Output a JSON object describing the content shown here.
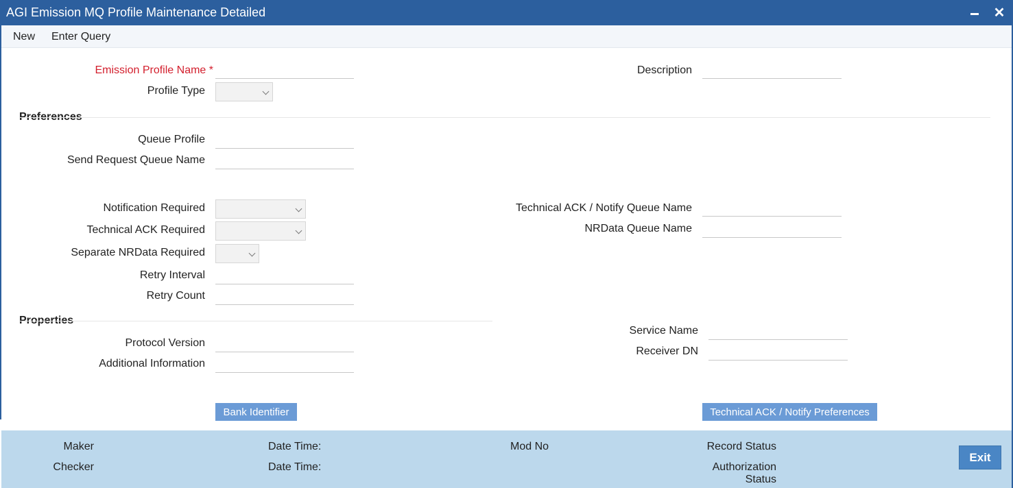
{
  "window": {
    "title": "AGI Emission MQ Profile Maintenance Detailed"
  },
  "menu": {
    "new": "New",
    "enter_query": "Enter Query"
  },
  "form": {
    "emission_profile_name": {
      "label": "Emission Profile Name",
      "required_mark": "*",
      "value": ""
    },
    "description": {
      "label": "Description",
      "value": ""
    },
    "profile_type": {
      "label": "Profile Type",
      "value": ""
    },
    "queue_profile": {
      "label": "Queue Profile",
      "value": ""
    },
    "send_request_queue_name": {
      "label": "Send Request Queue Name",
      "value": ""
    },
    "notification_required": {
      "label": "Notification Required",
      "value": ""
    },
    "technical_ack_required": {
      "label": "Technical ACK Required",
      "value": ""
    },
    "separate_nrdata_required": {
      "label": "Separate NRData Required",
      "value": ""
    },
    "retry_interval": {
      "label": "Retry Interval",
      "value": ""
    },
    "retry_count": {
      "label": "Retry Count",
      "value": ""
    },
    "technical_ack_notify_queue_name": {
      "label": "Technical ACK / Notify Queue Name",
      "value": ""
    },
    "nrdata_queue_name": {
      "label": "NRData Queue Name",
      "value": ""
    },
    "protocol_version": {
      "label": "Protocol Version",
      "value": ""
    },
    "additional_information": {
      "label": "Additional Information",
      "value": ""
    },
    "service_name": {
      "label": "Service Name",
      "value": ""
    },
    "receiver_dn": {
      "label": "Receiver DN",
      "value": ""
    }
  },
  "sections": {
    "preferences": "Preferences",
    "properties": "Properties"
  },
  "buttons": {
    "bank_identifier": "Bank Identifier",
    "technical_ack_notify_preferences": "Technical ACK / Notify Preferences",
    "exit": "Exit"
  },
  "footer": {
    "maker": "Maker",
    "checker": "Checker",
    "date_time_1": "Date Time:",
    "date_time_2": "Date Time:",
    "mod_no": "Mod No",
    "record_status": "Record Status",
    "authorization_status_line1": "Authorization",
    "authorization_status_line2": "Status"
  },
  "colors": {
    "title_bar": "#2c5f9e",
    "required_label": "#d31f2d",
    "action_button": "#6b9bd6",
    "footer_bg": "#bcd8ec",
    "exit_button": "#4a86c5"
  },
  "icons": {
    "minimize": "minimize-icon",
    "close": "close-icon",
    "dropdown": "chevron-down-icon"
  }
}
